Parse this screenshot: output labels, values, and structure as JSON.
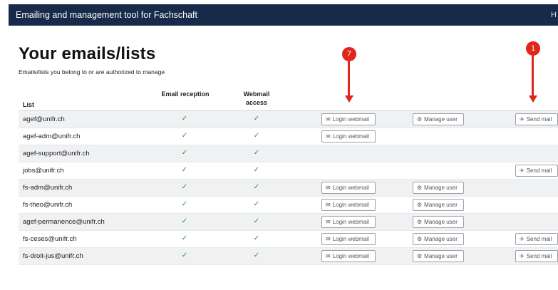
{
  "topbar": {
    "title": "Emailing and management tool for Fachschaft",
    "right_text": "H"
  },
  "page": {
    "title": "Your emails/lists",
    "subtitle": "Emails/lists you belong to or are authorized to manage"
  },
  "table": {
    "headers": {
      "list": "List",
      "email_reception": "Email reception",
      "webmail_access": "Webmail access"
    },
    "rows": [
      {
        "list": "agef@unifr.ch",
        "email_reception": true,
        "webmail_access": true,
        "login_webmail": true,
        "manage_user": true,
        "send_mail": true
      },
      {
        "list": "agef-adm@unifr.ch",
        "email_reception": true,
        "webmail_access": true,
        "login_webmail": true,
        "manage_user": false,
        "send_mail": false
      },
      {
        "list": "agef-support@unifr.ch",
        "email_reception": true,
        "webmail_access": true,
        "login_webmail": false,
        "manage_user": false,
        "send_mail": false
      },
      {
        "list": "jobs@unifr.ch",
        "email_reception": true,
        "webmail_access": true,
        "login_webmail": false,
        "manage_user": false,
        "send_mail": true
      },
      {
        "list": "fs-adm@unifr.ch",
        "email_reception": true,
        "webmail_access": true,
        "login_webmail": true,
        "manage_user": true,
        "send_mail": false
      },
      {
        "list": "fs-theo@unifr.ch",
        "email_reception": true,
        "webmail_access": true,
        "login_webmail": true,
        "manage_user": true,
        "send_mail": false
      },
      {
        "list": "agef-permanence@unifr.ch",
        "email_reception": true,
        "webmail_access": true,
        "login_webmail": true,
        "manage_user": true,
        "send_mail": false
      },
      {
        "list": "fs-ceses@unifr.ch",
        "email_reception": true,
        "webmail_access": true,
        "login_webmail": true,
        "manage_user": true,
        "send_mail": true
      },
      {
        "list": "fs-droit-jus@unifr.ch",
        "email_reception": true,
        "webmail_access": true,
        "login_webmail": true,
        "manage_user": true,
        "send_mail": true
      }
    ]
  },
  "buttons": {
    "login_webmail": "Login webmail",
    "manage_user": "Manage user",
    "send_mail": "Send mail"
  },
  "icons": {
    "check": "check-icon",
    "login": "envelope-icon",
    "manage": "gear-icon",
    "send": "paper-plane-icon"
  },
  "annotations": [
    {
      "label": "7"
    },
    {
      "label": "1"
    }
  ],
  "colors": {
    "topbar": "#182a4a",
    "check": "#2e8b57",
    "annotation": "#e0251b",
    "stripe": "#f0f1f3"
  }
}
